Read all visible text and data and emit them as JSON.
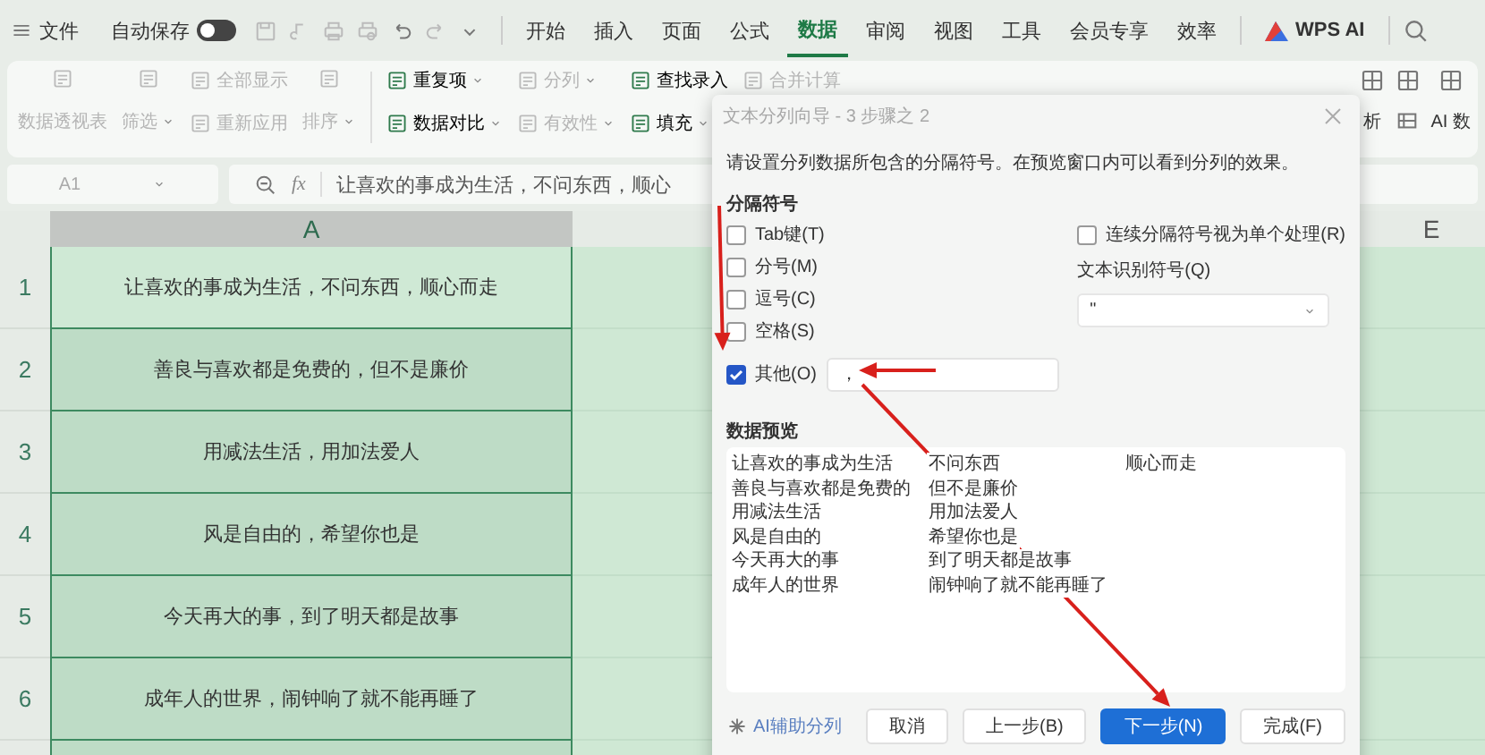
{
  "top_bar": {
    "menu_label": "文件",
    "autosave": {
      "label": "自动保存",
      "on": false
    },
    "tabs": [
      {
        "label": "开始",
        "selected": false
      },
      {
        "label": "插入",
        "selected": false
      },
      {
        "label": "页面",
        "selected": false
      },
      {
        "label": "公式",
        "selected": false
      },
      {
        "label": "数据",
        "selected": true
      },
      {
        "label": "审阅",
        "selected": false
      },
      {
        "label": "视图",
        "selected": false
      },
      {
        "label": "工具",
        "selected": false
      },
      {
        "label": "会员专享",
        "selected": false
      },
      {
        "label": "效率",
        "selected": false
      }
    ],
    "ai_tab": "WPS AI"
  },
  "ribbon": {
    "groups": [
      {
        "kind": "large",
        "items": [
          {
            "label": "数据透视表",
            "dropdown": false,
            "disabled": true
          }
        ]
      },
      {
        "kind": "large",
        "items": [
          {
            "label": "筛选",
            "dropdown": true,
            "disabled": true
          }
        ]
      },
      {
        "kind": "stack",
        "items": [
          {
            "label": "全部显示",
            "dropdown": false,
            "disabled": true
          },
          {
            "label": "重新应用",
            "dropdown": false,
            "disabled": true
          }
        ]
      },
      {
        "kind": "large",
        "items": [
          {
            "label": "排序",
            "dropdown": true,
            "disabled": true
          }
        ]
      },
      {
        "kind": "stack",
        "items": [
          {
            "label": "重复项",
            "dropdown": true,
            "disabled": false
          },
          {
            "label": "数据对比",
            "dropdown": true,
            "disabled": false
          }
        ]
      },
      {
        "kind": "stack",
        "items": [
          {
            "label": "分列",
            "dropdown": true,
            "disabled": true
          },
          {
            "label": "有效性",
            "dropdown": true,
            "disabled": true
          }
        ]
      },
      {
        "kind": "stack",
        "items": [
          {
            "label": "查找录入",
            "dropdown": false,
            "disabled": false
          },
          {
            "label": "填充",
            "dropdown": true,
            "disabled": false
          }
        ]
      },
      {
        "kind": "stack",
        "items": [
          {
            "label": "合并计算",
            "dropdown": false,
            "disabled": true
          }
        ]
      }
    ],
    "right_items": [
      {
        "kind": "labeled",
        "label": "析"
      },
      {
        "kind": "icon"
      },
      {
        "kind": "labeled",
        "label": "AI 数"
      }
    ]
  },
  "formula_bar": {
    "cell_ref": "A1",
    "function_label": "fx",
    "formula": "让喜欢的事成为生活，不问东西，顺心"
  },
  "sheet": {
    "columns": [
      "A",
      "E"
    ],
    "rows": [
      {
        "number": "1",
        "value": "让喜欢的事成为生活，不问东西，顺心而走",
        "selected": true
      },
      {
        "number": "2",
        "value": "善良与喜欢都是免费的，但不是廉价",
        "selected": false
      },
      {
        "number": "3",
        "value": "用减法生活，用加法爱人",
        "selected": false
      },
      {
        "number": "4",
        "value": "风是自由的，希望你也是",
        "selected": false
      },
      {
        "number": "5",
        "value": "今天再大的事，到了明天都是故事",
        "selected": false
      },
      {
        "number": "6",
        "value": "成年人的世界，闹钟响了就不能再睡了",
        "selected": false
      }
    ]
  },
  "dialog": {
    "title": "文本分列向导 - 3 步骤之 2",
    "description": "请设置分列数据所包含的分隔符号。在预览窗口内可以看到分列的效果。",
    "delimiter_heading": "分隔符号",
    "delimiters": [
      {
        "kind": "checkbox",
        "label": "Tab键(T)",
        "checked": false
      },
      {
        "kind": "checkbox",
        "label": "分号(M)",
        "checked": false
      },
      {
        "kind": "checkbox",
        "label": "逗号(C)",
        "checked": false
      },
      {
        "kind": "checkbox",
        "label": "空格(S)",
        "checked": false
      },
      {
        "kind": "checkbox_field",
        "label": "其他(O)",
        "checked": true,
        "value": "，"
      }
    ],
    "consecutive": {
      "label": "连续分隔符号视为单个处理(R)",
      "checked": false
    },
    "qualifier": {
      "label": "文本识别符号(Q)",
      "value": "\""
    },
    "preview_heading": "数据预览",
    "preview_rows": [
      [
        "让喜欢的事成为生活",
        "不问东西",
        "顺心而走"
      ],
      [
        "善良与喜欢都是免费的",
        "但不是廉价"
      ],
      [
        "用减法生活",
        "用加法爱人"
      ],
      [
        "风是自由的",
        "希望你也是"
      ],
      [
        "今天再大的事",
        "到了明天都是故事"
      ],
      [
        "成年人的世界",
        "闹钟响了就不能再睡了"
      ]
    ],
    "ai_link": "AI辅助分列",
    "buttons": [
      {
        "label": "取消",
        "primary": false
      },
      {
        "label": "上一步(B)",
        "primary": false
      },
      {
        "label": "下一步(N)",
        "primary": true
      },
      {
        "label": "完成(F)",
        "primary": false
      }
    ]
  }
}
